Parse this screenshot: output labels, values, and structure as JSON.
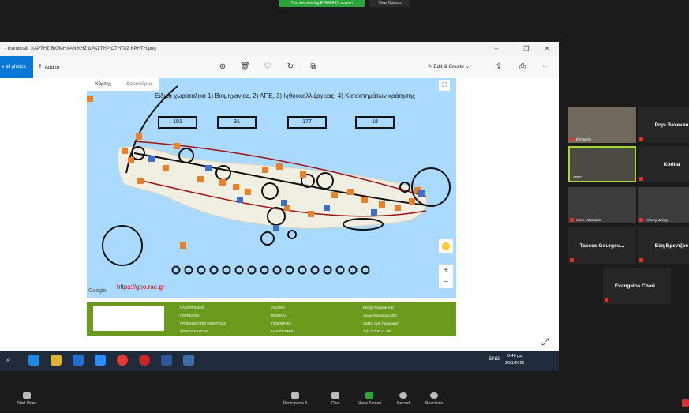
{
  "zoom_top": {
    "share_banner": "You are viewing ETAM AE's screen",
    "view_options": "View Options"
  },
  "photos": {
    "title": "- thumbnail_ΧΑΡΤΗΣ ΒΙΟΜΗΧΑΝΙΚΗΣ ΔΡΑΣΤΗΡΙΟΤΗΤΑΣ ΚΡΗΤΗ.png",
    "see_all": "e all photos",
    "add_to": "Add to",
    "edit_create": "Edit & Create"
  },
  "map": {
    "tab_map": "Χάρτης",
    "tab_satellite": "Δορυφόρος",
    "title": "Ειδικά χωροταξικά 1) Βιομηχανίας, 2) ΑΠΕ, 3) Ιχθυοκαλλιέργειας, 4) Καταστημάτων κράτησης",
    "counts": [
      "191",
      "31",
      "177",
      "18"
    ],
    "link": "https://geo.rae.gr",
    "google": "Google"
  },
  "footer": {
    "col1": [
      "ΗΛΕΚΤΡΙΣΜΟΣ",
      "ΠΕΤΡΕΛΑΙΟ",
      "ΠΡΟΜΗΘΕΥΤΕΣ ΕΝΕΡΓΕΙΑΣ",
      "ΣΤΕΡΕΑ ΚΑΥΣΙΜΑ"
    ],
    "col2": [
      "ΑΙΟΛΙΚΑ",
      "ΒΙΟΜΑΖΑ",
      "ΓΕΩΘΕΡΜΙΑ",
      "ΗΛΙΟΘΕΡΜΙΚΑ"
    ],
    "col3": [
      "Energy Register A.E.",
      "Λεωφ. Μεσογείων 336",
      "15341, Αγία Παρασκευή",
      "Τηλ: 210 65 11 393"
    ]
  },
  "taskbar": {
    "lang": "ENG",
    "time": "6:40 μμ",
    "date": "20/1/2021"
  },
  "participants": [
    {
      "label": "ETAM AE",
      "name": ""
    },
    {
      "label": "",
      "name": "Popi Baxevan"
    },
    {
      "label": "ΑΡΓΟ",
      "name": ""
    },
    {
      "label": "",
      "name": "Korina"
    },
    {
      "label": "nikos Vitsakakis",
      "name": ""
    },
    {
      "label": "Γιάννης Δελήγ...",
      "name": ""
    },
    {
      "label": "",
      "name": "Tassos Gourgou..."
    },
    {
      "label": "",
      "name": "Εύη Βρεντζου"
    },
    {
      "label": "",
      "name": "Evangelos Chari..."
    }
  ],
  "zoom_bar": {
    "start_video": "Start Video",
    "participants": "Participants",
    "participants_count": "9",
    "chat": "Chat",
    "share_screen": "Share Screen",
    "record": "Record",
    "reactions": "Reactions"
  },
  "colors": {
    "map_water": "#aadaff",
    "footer_green": "#6a9b1c",
    "accent": "#0a78d7",
    "share_green": "#2aa53a"
  }
}
